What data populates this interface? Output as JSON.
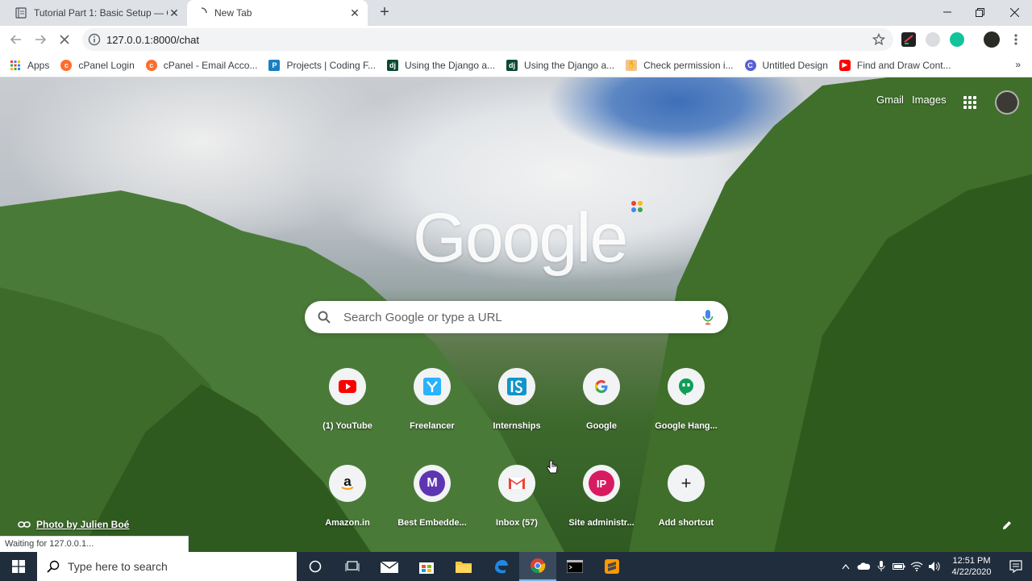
{
  "browser": {
    "tabs": [
      {
        "title": "Tutorial Part 1: Basic Setup — Ch",
        "icon": "document-icon",
        "active": false
      },
      {
        "title": "New Tab",
        "icon": "loading-spinner-icon",
        "active": true
      }
    ],
    "address": "127.0.0.1:8000/chat",
    "bookmarks": [
      {
        "label": "Apps",
        "icon": "apps-grid-icon"
      },
      {
        "label": "cPanel Login",
        "icon": "cpanel-icon"
      },
      {
        "label": "cPanel - Email Acco...",
        "icon": "cpanel-icon"
      },
      {
        "label": "Projects | Coding F...",
        "icon": "projects-icon"
      },
      {
        "label": "Using the Django a...",
        "icon": "django-icon"
      },
      {
        "label": "Using the Django a...",
        "icon": "django-icon"
      },
      {
        "label": "Check permission i...",
        "icon": "hand-icon"
      },
      {
        "label": "Untitled Design",
        "icon": "canva-icon"
      },
      {
        "label": "Find and Draw Cont...",
        "icon": "youtube-icon"
      }
    ],
    "bookmarks_more": "»",
    "status_text": "Waiting for 127.0.0.1..."
  },
  "ntp": {
    "gmail_link": "Gmail",
    "images_link": "Images",
    "logo_text": "Google",
    "search_placeholder": "Search Google or type a URL",
    "shortcuts": [
      {
        "label": "(1) YouTube",
        "icon": "youtube-icon"
      },
      {
        "label": "Freelancer",
        "icon": "freelancer-icon"
      },
      {
        "label": "Internships",
        "icon": "internshala-icon"
      },
      {
        "label": "Google",
        "icon": "google-g-icon"
      },
      {
        "label": "Google Hang...",
        "icon": "hangouts-icon"
      },
      {
        "label": "Amazon.in",
        "icon": "amazon-icon"
      },
      {
        "label": "Best Embedde...",
        "icon": "m-letter-icon"
      },
      {
        "label": "Inbox (57)",
        "icon": "gmail-icon"
      },
      {
        "label": "Site administr...",
        "icon": "ip-letter-icon"
      },
      {
        "label": "Add shortcut",
        "icon": "plus-icon"
      }
    ],
    "letters": {
      "m": "M",
      "ip": "IP",
      "plus": "+",
      "amazon": "a"
    },
    "photo_credit": "Photo by Julien Boé"
  },
  "taskbar": {
    "search_placeholder": "Type here to search",
    "time": "12:51 PM",
    "date": "4/22/2020"
  },
  "colors": {
    "accent_blue": "#1a73e8",
    "taskbar": "#1f2d3d"
  }
}
